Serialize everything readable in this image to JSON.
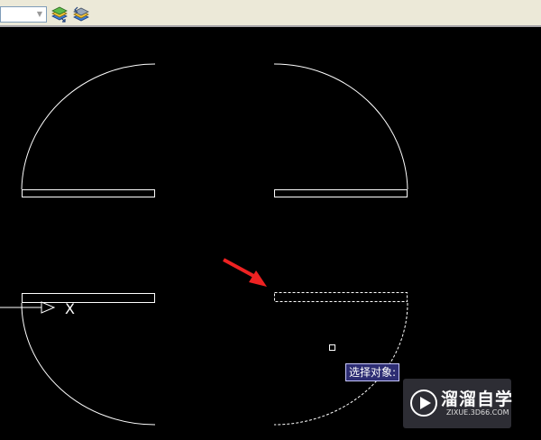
{
  "toolbar": {
    "layer_combo": {
      "value": ""
    },
    "icons": [
      "layer-states-icon",
      "layer-previous-icon"
    ]
  },
  "canvas": {
    "background": "#000000",
    "line_color": "#ffffff",
    "arrow_color": "#ee2222",
    "ucs_axis_label": "X"
  },
  "tooltip": {
    "text": "选择对象:"
  },
  "watermark": {
    "name": "溜溜自学",
    "url": "ZIXUE.3D66.COM"
  }
}
